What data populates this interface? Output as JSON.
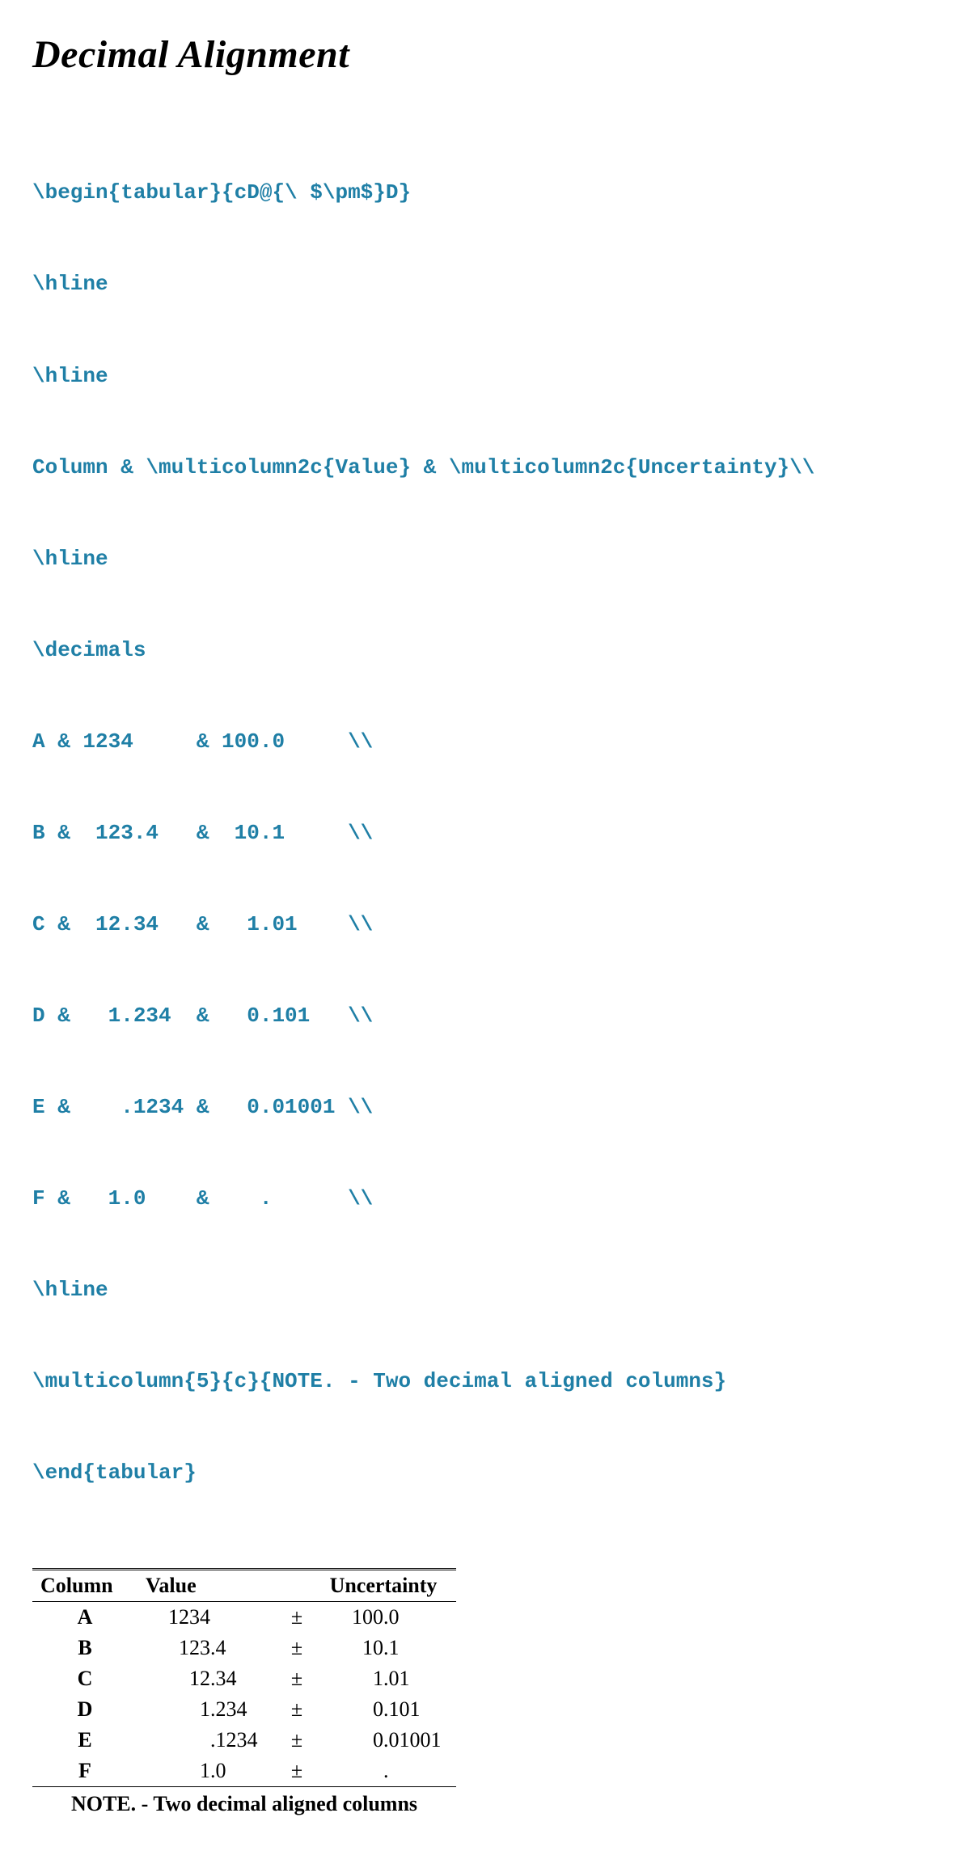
{
  "heading": "Decimal Alignment",
  "code": {
    "lines": [
      "\\begin{tabular}{cD@{\\ $\\pm$}D}",
      "\\hline",
      "\\hline",
      "Column & \\multicolumn2c{Value} & \\multicolumn2c{Uncertainty}\\\\",
      "\\hline",
      "\\decimals",
      "A & 1234     & 100.0     \\\\",
      "B &  123.4   &  10.1     \\\\",
      "C &  12.34   &   1.01    \\\\",
      "D &   1.234  &   0.101   \\\\",
      "E &    .1234 &   0.01001 \\\\",
      "F &   1.0    &    .      \\\\",
      "\\hline",
      "\\multicolumn{5}{c}{NOTE. - Two decimal aligned columns}",
      "\\end{tabular}"
    ]
  },
  "table": {
    "headers": {
      "col": "Column",
      "val": "Value",
      "unc": "Uncertainty"
    },
    "pm": "±",
    "rows": [
      {
        "label": "A",
        "vi": "1234",
        "vf": "",
        "ui": "100",
        "uf": ".0"
      },
      {
        "label": "B",
        "vi": "123",
        "vf": ".4",
        "ui": "10",
        "uf": ".1"
      },
      {
        "label": "C",
        "vi": "12",
        "vf": ".34",
        "ui": "1",
        "uf": ".01"
      },
      {
        "label": "D",
        "vi": "1",
        "vf": ".234",
        "ui": "0",
        "uf": ".101"
      },
      {
        "label": "E",
        "vi": "",
        "vf": ".1234",
        "ui": "0",
        "uf": ".01001"
      },
      {
        "label": "F",
        "vi": "1",
        "vf": ".0",
        "ui": "",
        "uf": "."
      }
    ],
    "note": "NOTE. - Two decimal aligned columns"
  }
}
